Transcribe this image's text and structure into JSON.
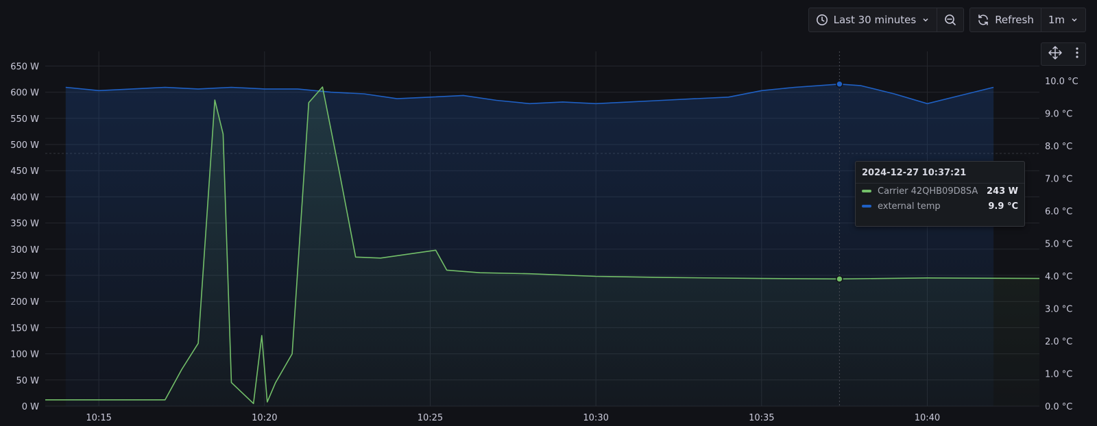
{
  "toolbar": {
    "time_range": "Last 30 minutes",
    "refresh_label": "Refresh",
    "refresh_interval": "1m"
  },
  "colors": {
    "power": "#73bf69",
    "temp": "#1f60c4",
    "grid": "#25272d",
    "text": "#ccccdc"
  },
  "tooltip": {
    "time": "2024-12-27 10:37:21",
    "rows": [
      {
        "name": "Carrier 42QHB09D8SA",
        "value": "243 W"
      },
      {
        "name": "external temp",
        "value": "9.9 °C"
      }
    ]
  },
  "chart_data": {
    "type": "line",
    "x_ticks": [
      "10:15",
      "10:20",
      "10:25",
      "10:30",
      "10:35",
      "10:40"
    ],
    "y_left_ticks": [
      "0 W",
      "50 W",
      "100 W",
      "150 W",
      "200 W",
      "250 W",
      "300 W",
      "350 W",
      "400 W",
      "450 W",
      "500 W",
      "550 W",
      "600 W",
      "650 W"
    ],
    "y_right_ticks": [
      "0.0 °C",
      "1.0 °C",
      "2.0 °C",
      "3.0 °C",
      "4.0 °C",
      "5.0 °C",
      "6.0 °C",
      "7.0 °C",
      "8.0 °C",
      "9.0 °C",
      "10.0 °C"
    ],
    "y_left_range": [
      0,
      650
    ],
    "y_right_range": [
      0,
      10
    ],
    "x_range": [
      "10:13:23",
      "10:43:23"
    ],
    "grid": true,
    "hover_x": "10:37:21",
    "series": [
      {
        "name": "Carrier 42QHB09D8SA",
        "axis": "left",
        "x": [
          "10:13:23",
          "10:17:00",
          "10:17:30",
          "10:18:00",
          "10:18:30",
          "10:18:45",
          "10:19:00",
          "10:19:40",
          "10:19:55",
          "10:20:05",
          "10:20:20",
          "10:20:50",
          "10:21:20",
          "10:21:45",
          "10:22:15",
          "10:22:45",
          "10:23:30",
          "10:25:10",
          "10:25:30",
          "10:26:30",
          "10:28:00",
          "10:30:00",
          "10:32:00",
          "10:35:00",
          "10:37:21",
          "10:40:00",
          "10:43:23"
        ],
        "values": [
          12,
          12,
          70,
          120,
          585,
          520,
          45,
          5,
          135,
          8,
          45,
          100,
          580,
          610,
          450,
          285,
          283,
          298,
          260,
          255,
          253,
          248,
          246,
          244,
          243,
          245,
          244
        ]
      },
      {
        "name": "external temp",
        "axis": "right",
        "x": [
          "10:14:00",
          "10:15:00",
          "10:16:00",
          "10:17:00",
          "10:18:00",
          "10:19:00",
          "10:20:00",
          "10:21:00",
          "10:22:00",
          "10:23:00",
          "10:24:00",
          "10:25:00",
          "10:26:00",
          "10:27:00",
          "10:28:00",
          "10:29:00",
          "10:30:00",
          "10:31:00",
          "10:32:00",
          "10:33:00",
          "10:34:00",
          "10:35:00",
          "10:36:00",
          "10:37:21",
          "10:38:00",
          "10:39:00",
          "10:40:00",
          "10:41:00",
          "10:42:00"
        ],
        "values": [
          9.8,
          9.7,
          9.75,
          9.8,
          9.75,
          9.8,
          9.75,
          9.75,
          9.65,
          9.6,
          9.45,
          9.5,
          9.55,
          9.4,
          9.3,
          9.35,
          9.3,
          9.35,
          9.4,
          9.45,
          9.5,
          9.7,
          9.8,
          9.9,
          9.85,
          9.6,
          9.3,
          9.55,
          9.8
        ]
      }
    ]
  }
}
